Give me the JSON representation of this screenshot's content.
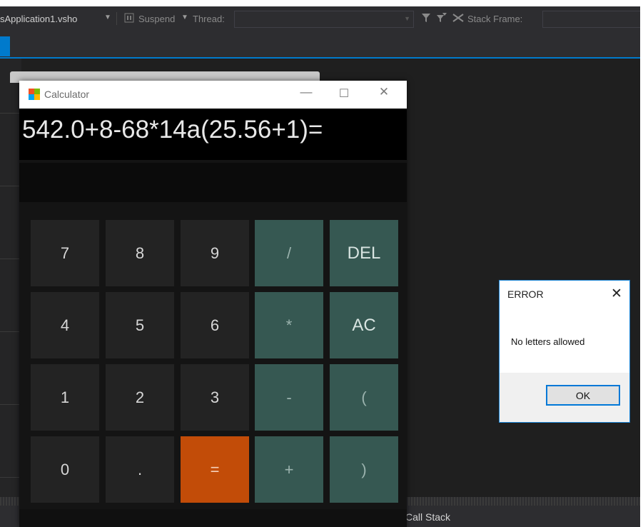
{
  "toolbar": {
    "project": "sApplication1.vsho",
    "suspend": "Suspend",
    "thread_label": "Thread:",
    "stack_frame_label": "Stack Frame:"
  },
  "calculator": {
    "title": "Calculator",
    "minimize": "—",
    "maximize": "☐",
    "close": "✕",
    "expression": "542.0+8-68*14a(25.56+1)=",
    "result": "",
    "keys": [
      [
        "7",
        "8",
        "9",
        "/",
        "DEL"
      ],
      [
        "4",
        "5",
        "6",
        "*",
        "AC"
      ],
      [
        "1",
        "2",
        "3",
        "-",
        "("
      ],
      [
        "0",
        ".",
        "=",
        "+",
        ")"
      ]
    ],
    "colors": {
      "digit_key": "#232323",
      "operator_key": "#365852",
      "equals_key": "#c24c08"
    }
  },
  "error_dialog": {
    "title": "ERROR",
    "close": "✕",
    "message": "No letters allowed",
    "ok_label": "OK"
  },
  "panels": {
    "call_stack": "Call Stack"
  },
  "icons": [
    "filter-icon",
    "filter-thread-icon",
    "clear-filter-icon",
    "calculator-app-icon"
  ]
}
